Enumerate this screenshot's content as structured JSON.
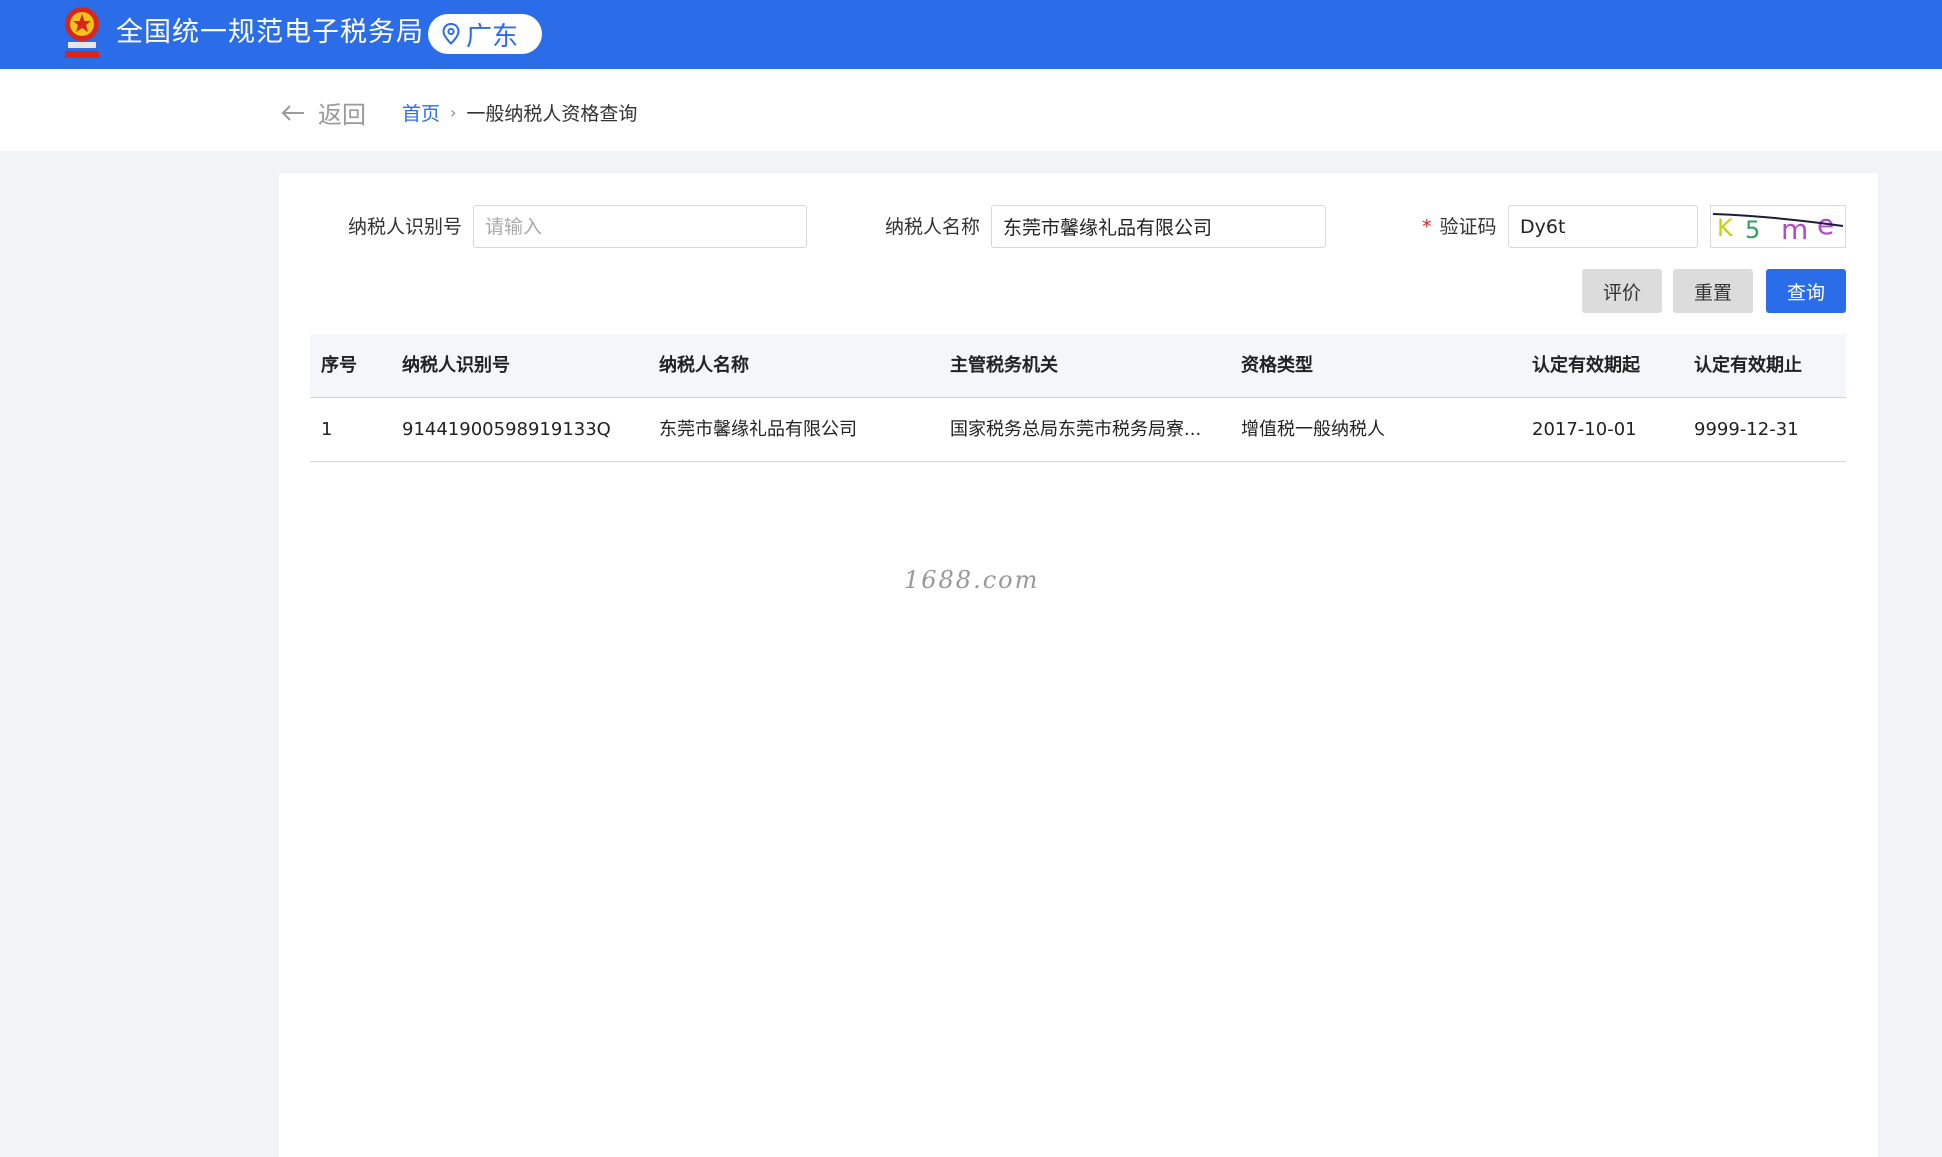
{
  "header": {
    "site_title": "全国统一规范电子税务局",
    "region": "广东",
    "colors": {
      "brand": "#2b6de8"
    }
  },
  "breadcrumb": {
    "back_label": "返回",
    "home": "首页",
    "current": "一般纳税人资格查询"
  },
  "form": {
    "taxpayer_id_label": "纳税人识别号",
    "taxpayer_id_placeholder": "请输入",
    "taxpayer_id_value": "",
    "taxpayer_name_label": "纳税人名称",
    "taxpayer_name_value": "东莞市馨缘礼品有限公司",
    "captcha_required_mark": "*",
    "captcha_label": "验证码",
    "captcha_value": "Dy6t",
    "captcha_image_text": "K5me"
  },
  "buttons": {
    "evaluate": "评价",
    "reset": "重置",
    "query": "查询"
  },
  "table": {
    "headers": [
      "序号",
      "纳税人识别号",
      "纳税人名称",
      "主管税务机关",
      "资格类型",
      "认定有效期起",
      "认定有效期止"
    ],
    "rows": [
      [
        "1",
        "91441900598919133Q",
        "东莞市馨缘礼品有限公司",
        "国家税务总局东莞市税务局寮...",
        "增值税一般纳税人",
        "2017-10-01",
        "9999-12-31"
      ]
    ]
  },
  "watermark": "1688.com"
}
